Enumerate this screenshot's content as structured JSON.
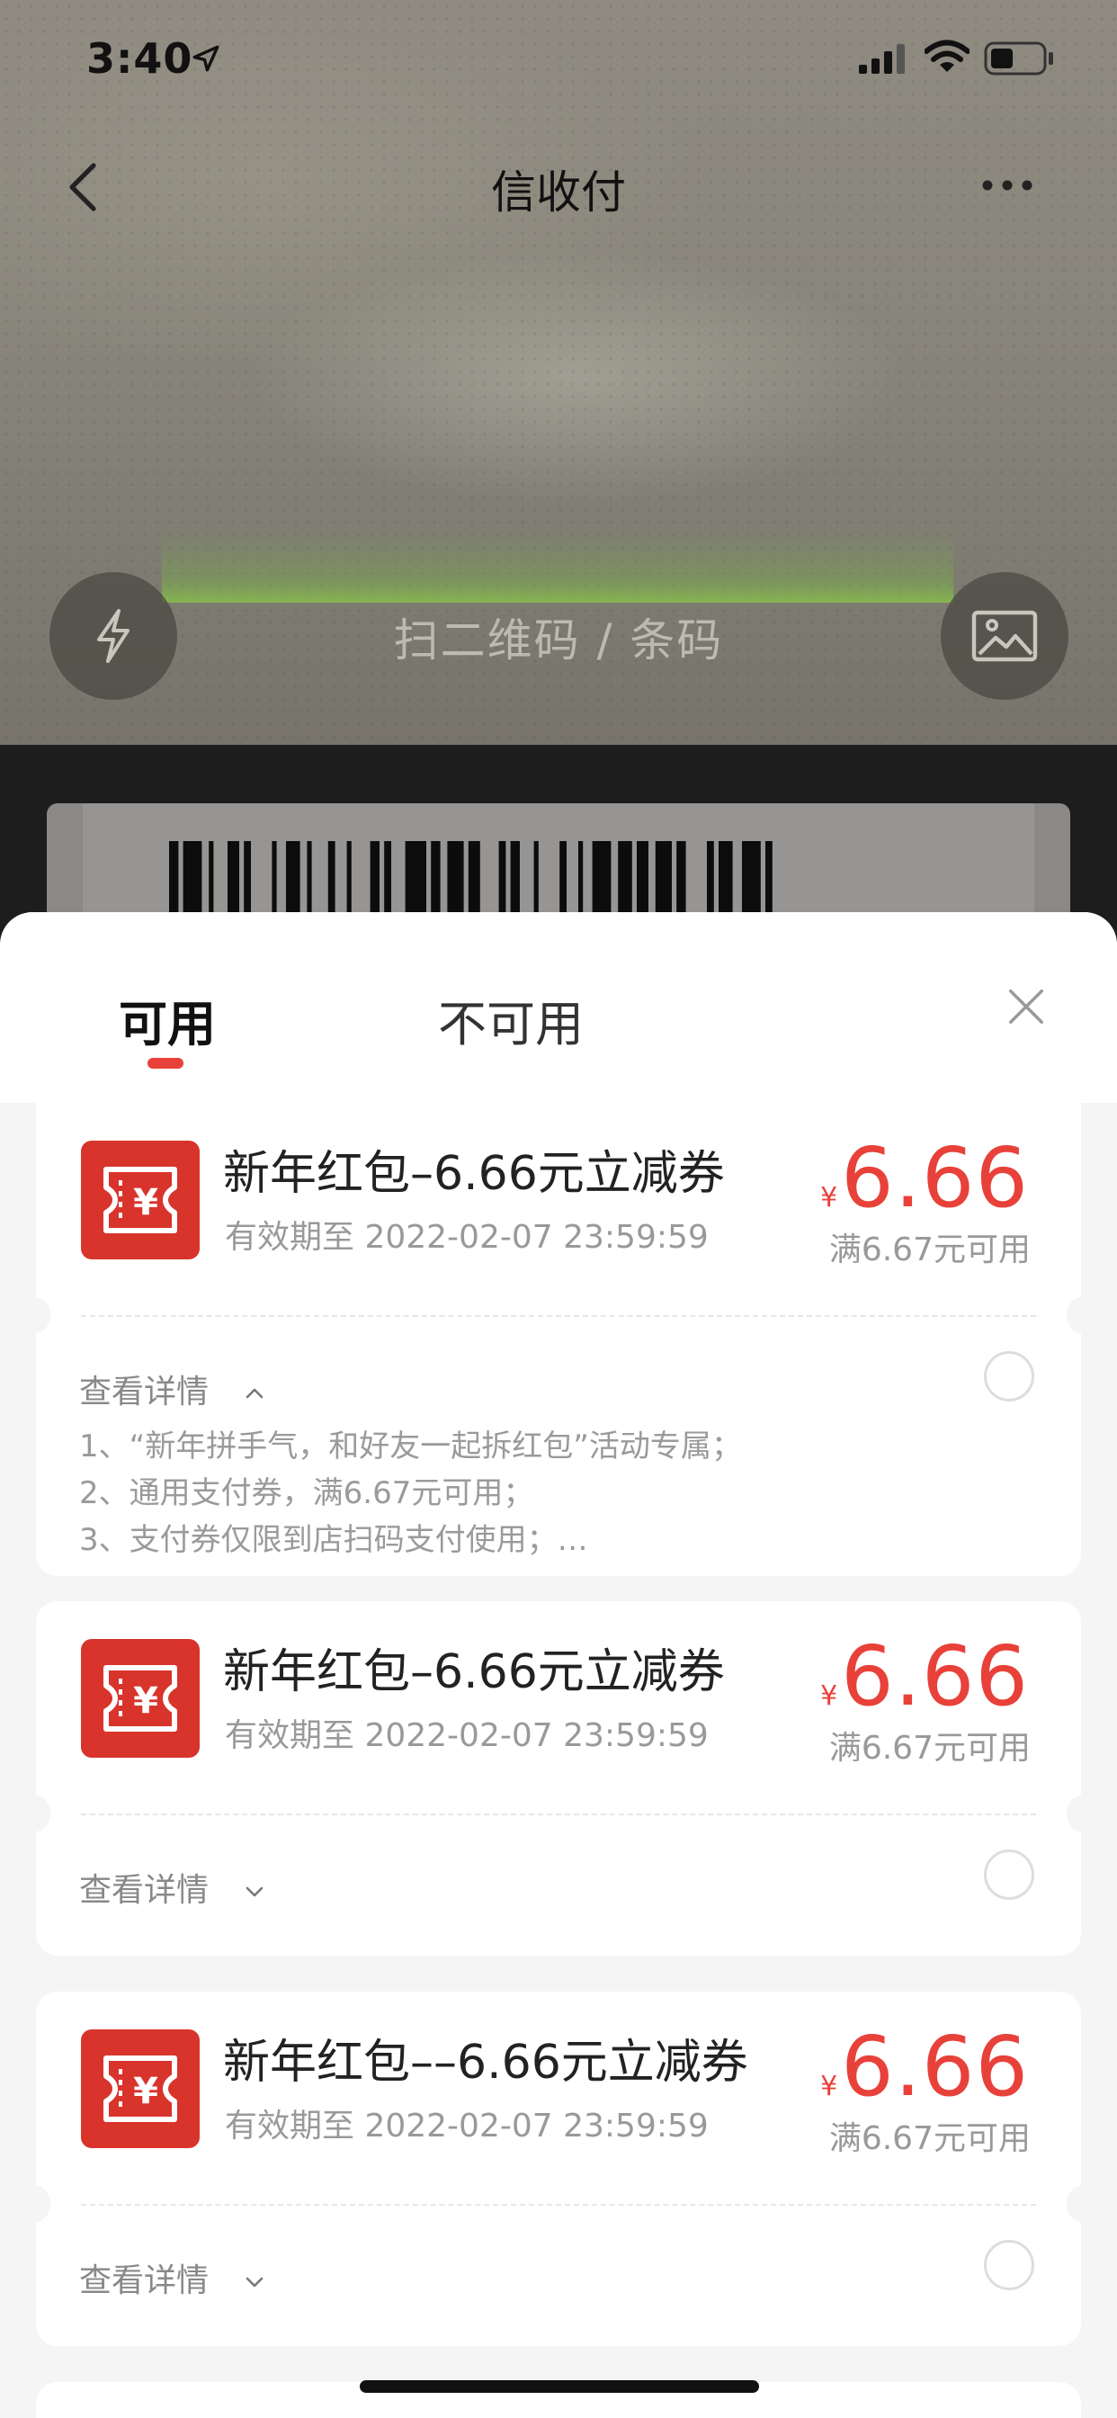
{
  "status_bar": {
    "time": "3:40"
  },
  "navbar": {
    "title": "信收付"
  },
  "scanner": {
    "hint": "扫二维码 / 条码"
  },
  "sheet": {
    "tabs": [
      {
        "label": "可用",
        "active": true
      },
      {
        "label": "不可用",
        "active": false
      }
    ],
    "accent_color": "#e8413a",
    "coupons": [
      {
        "title": "新年红包–6.66元立减券",
        "expiry": "有效期至 2022-02-07 23:59:59",
        "currency": "¥",
        "amount": "6.66",
        "condition": "满6.67元可用",
        "details_label": "查看详情",
        "expanded": true,
        "details": [
          "1、“新年拼手气，和好友一起拆红包”活动专属；",
          "2、通用支付券，满6.67元可用；",
          "3、支付券仅限到店扫码支付使用；…"
        ]
      },
      {
        "title": "新年红包–6.66元立减券",
        "expiry": "有效期至 2022-02-07 23:59:59",
        "currency": "¥",
        "amount": "6.66",
        "condition": "满6.67元可用",
        "details_label": "查看详情",
        "expanded": false
      },
      {
        "title": "新年红包––6.66元立减券",
        "expiry": "有效期至 2022-02-07 23:59:59",
        "currency": "¥",
        "amount": "6.66",
        "condition": "满6.67元可用",
        "details_label": "查看详情",
        "expanded": false
      }
    ]
  }
}
